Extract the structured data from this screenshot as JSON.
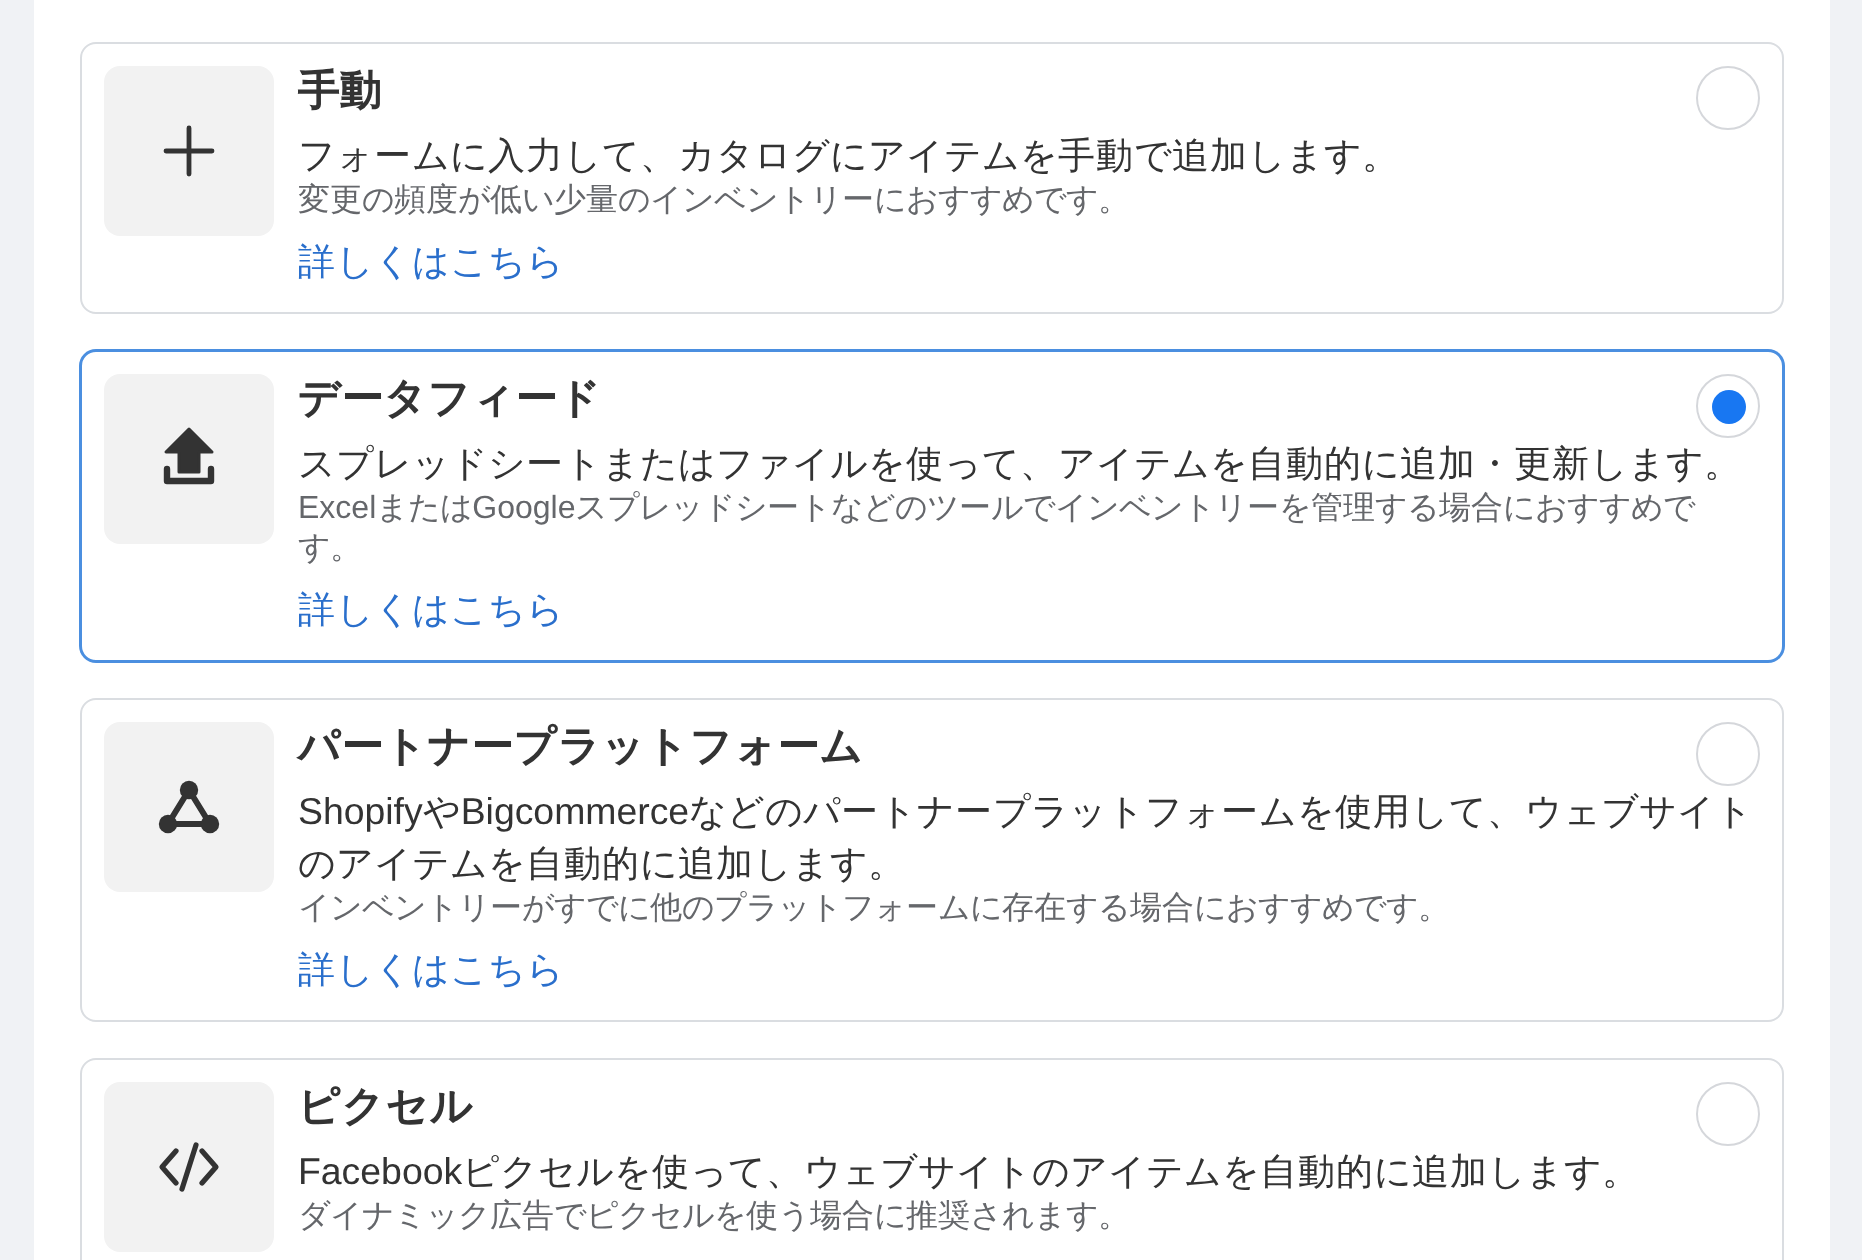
{
  "options": [
    {
      "kind": "manual",
      "title": "手動",
      "description": "フォームに入力して、カタログにアイテムを手動で追加します。",
      "hint": "変更の頻度が低い少量のインベントリーにおすすめです。",
      "link": "詳しくはこちら",
      "selected": false
    },
    {
      "kind": "feed",
      "title": "データフィード",
      "description": "スプレッドシートまたはファイルを使って、アイテムを自動的に追加・更新します。",
      "hint": "ExcelまたはGoogleスプレッドシートなどのツールでインベントリーを管理する場合におすすめです。",
      "link": "詳しくはこちら",
      "selected": true
    },
    {
      "kind": "partner",
      "title": "パートナープラットフォーム",
      "description": "ShopifyやBigcommerceなどのパートナープラットフォームを使用して、ウェブサイトのアイテムを自動的に追加します。",
      "hint": "インベントリーがすでに他のプラットフォームに存在する場合におすすめです。",
      "link": "詳しくはこちら",
      "selected": false
    },
    {
      "kind": "pixel",
      "title": "ピクセル",
      "description": "Facebookピクセルを使って、ウェブサイトのアイテムを自動的に追加します。",
      "hint": "ダイナミック広告でピクセルを使う場合に推奨されます。",
      "selected": false
    }
  ]
}
